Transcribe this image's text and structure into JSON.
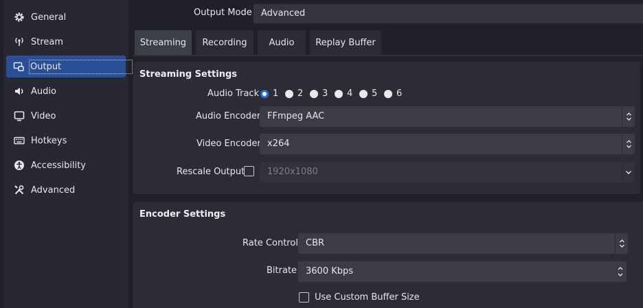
{
  "sidebar": {
    "items": [
      {
        "label": "General",
        "icon": "gear-icon"
      },
      {
        "label": "Stream",
        "icon": "broadcast-icon"
      },
      {
        "label": "Output",
        "icon": "output-icon"
      },
      {
        "label": "Audio",
        "icon": "speaker-icon"
      },
      {
        "label": "Video",
        "icon": "monitor-icon"
      },
      {
        "label": "Hotkeys",
        "icon": "keyboard-icon"
      },
      {
        "label": "Accessibility",
        "icon": "accessibility-icon"
      },
      {
        "label": "Advanced",
        "icon": "tools-icon"
      }
    ],
    "active": "Output"
  },
  "output_mode": {
    "label": "Output Mode",
    "value": "Advanced"
  },
  "tabs": [
    {
      "label": "Streaming",
      "active": true
    },
    {
      "label": "Recording"
    },
    {
      "label": "Audio"
    },
    {
      "label": "Replay Buffer"
    }
  ],
  "streaming_settings": {
    "title": "Streaming Settings",
    "audio_track": {
      "label": "Audio Track",
      "options": [
        "1",
        "2",
        "3",
        "4",
        "5",
        "6"
      ],
      "selected": "1"
    },
    "audio_encoder": {
      "label": "Audio Encoder",
      "value": "FFmpeg AAC"
    },
    "video_encoder": {
      "label": "Video Encoder",
      "value": "x264"
    },
    "rescale_output": {
      "label": "Rescale Output",
      "checked": false,
      "value": "1920x1080"
    }
  },
  "encoder_settings": {
    "title": "Encoder Settings",
    "rate_control": {
      "label": "Rate Control",
      "value": "CBR"
    },
    "bitrate": {
      "label": "Bitrate",
      "value": "3600 Kbps"
    },
    "custom_buffer": {
      "label": "Use Custom Buffer Size",
      "checked": false
    }
  },
  "colors": {
    "accent": "#2a4f96",
    "radio_checked": "#2a6fd6",
    "background": "#1f2029"
  }
}
